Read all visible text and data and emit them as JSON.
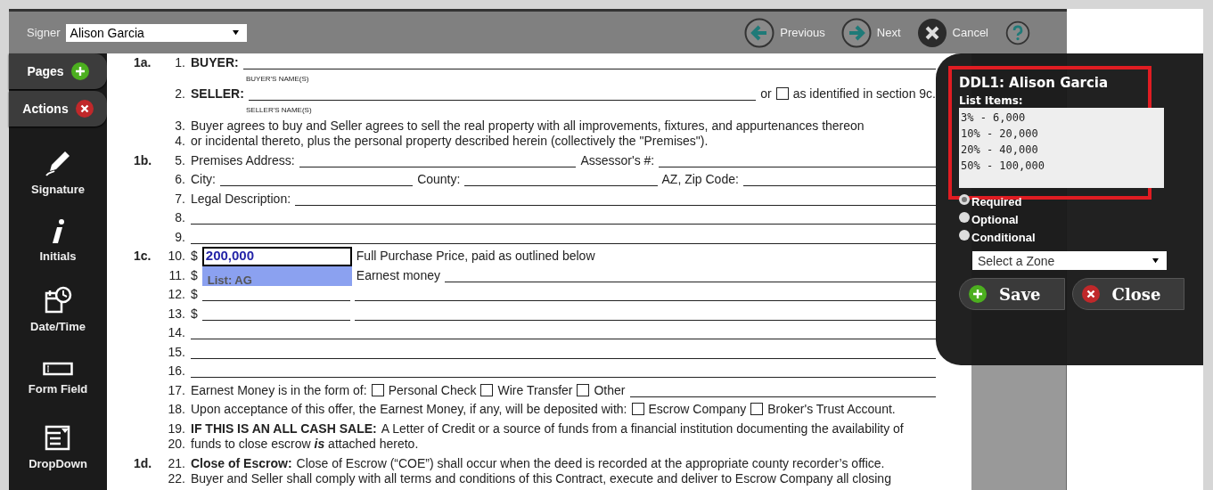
{
  "signer": {
    "label": "Signer",
    "value": "Alison Garcia"
  },
  "nav": [
    {
      "kind": "previous",
      "label": "Previous"
    },
    {
      "kind": "next",
      "label": "Next"
    },
    {
      "kind": "cancel",
      "label": "Cancel"
    },
    {
      "kind": "help"
    }
  ],
  "sidebar": {
    "tabs": [
      {
        "kind": "add",
        "label": "Pages"
      },
      {
        "kind": "remove",
        "label": "Actions"
      }
    ],
    "tools": [
      {
        "kind": "signature",
        "label": "Signature"
      },
      {
        "kind": "initials",
        "label": "Initials"
      },
      {
        "kind": "datetime",
        "label": "Date/Time"
      },
      {
        "kind": "formfield",
        "label": "Form Field"
      },
      {
        "kind": "dropdown",
        "label": "DropDown"
      }
    ]
  },
  "document": {
    "paragraphs": [
      {
        "section": "1a.",
        "lines": [
          {
            "number": "1.",
            "parts": [
              {
                "kind": "bold",
                "text": "BUYER:"
              },
              {
                "kind": "line"
              }
            ],
            "caption": "BUYER'S NAME(S)"
          }
        ]
      },
      {
        "lines": [
          {
            "number": "2.",
            "parts": [
              {
                "kind": "bold",
                "text": "SELLER:"
              },
              {
                "kind": "line"
              },
              {
                "kind": "text",
                "text": "or"
              },
              {
                "kind": "box",
                "checked": false
              },
              {
                "kind": "text",
                "text": "as identified in section 9c."
              }
            ],
            "caption": "SELLER'S NAME(S)"
          }
        ]
      },
      {
        "lines": [
          {
            "number": "3.",
            "parts": [
              {
                "kind": "text",
                "text": "Buyer agrees to buy and Seller agrees to sell the real property with all improvements, fixtures, and appurtenances thereon"
              }
            ]
          },
          {
            "number": "4.",
            "parts": [
              {
                "kind": "text",
                "text": "or incidental thereto, plus the personal property described herein (collectively the \"Premises\")."
              }
            ]
          }
        ]
      },
      {
        "section": "1b.",
        "lines": [
          {
            "number": "5.",
            "parts": [
              {
                "kind": "text",
                "text": "Premises Address:"
              },
              {
                "kind": "line"
              },
              {
                "kind": "text",
                "text": "Assessor's #:"
              },
              {
                "kind": "line"
              }
            ]
          }
        ]
      },
      {
        "lines": [
          {
            "number": "6.",
            "parts": [
              {
                "kind": "text",
                "text": "City:"
              },
              {
                "kind": "line"
              },
              {
                "kind": "text",
                "text": "County:"
              },
              {
                "kind": "line"
              },
              {
                "kind": "text",
                "text": "AZ, Zip Code:"
              },
              {
                "kind": "line"
              }
            ]
          }
        ]
      },
      {
        "lines": [
          {
            "number": "7.",
            "parts": [
              {
                "kind": "text",
                "text": "Legal Description:"
              },
              {
                "kind": "line"
              }
            ]
          }
        ]
      },
      {
        "lines": [
          {
            "number": "8.",
            "parts": [
              {
                "kind": "line"
              }
            ]
          }
        ]
      },
      {
        "lines": [
          {
            "number": "9.",
            "parts": [
              {
                "kind": "line"
              }
            ]
          }
        ]
      },
      {
        "section": "1c.",
        "lines": [
          {
            "number": "10.",
            "parts": [
              {
                "kind": "text",
                "text": "$"
              },
              {
                "kind": "placed_text",
                "value": "200,000"
              },
              {
                "kind": "text",
                "text": "Full Purchase Price, paid as outlined below"
              }
            ]
          }
        ]
      },
      {
        "lines": [
          {
            "number": "11.",
            "parts": [
              {
                "kind": "text",
                "text": "$"
              },
              {
                "kind": "placed_list",
                "label": "List: AG"
              },
              {
                "kind": "text",
                "text": "Earnest money"
              },
              {
                "kind": "line"
              }
            ]
          }
        ]
      },
      {
        "lines": [
          {
            "number": "12.",
            "parts": [
              {
                "kind": "text",
                "text": "$"
              },
              {
                "kind": "short"
              },
              {
                "kind": "line"
              }
            ]
          }
        ]
      },
      {
        "lines": [
          {
            "number": "13.",
            "parts": [
              {
                "kind": "text",
                "text": "$"
              },
              {
                "kind": "short"
              },
              {
                "kind": "line"
              }
            ]
          }
        ]
      },
      {
        "lines": [
          {
            "number": "14.",
            "parts": [
              {
                "kind": "line"
              }
            ]
          }
        ]
      },
      {
        "lines": [
          {
            "number": "15.",
            "parts": [
              {
                "kind": "line"
              }
            ]
          }
        ]
      },
      {
        "lines": [
          {
            "number": "16.",
            "parts": [
              {
                "kind": "line"
              }
            ]
          }
        ]
      },
      {
        "lines": [
          {
            "number": "17.",
            "parts": [
              {
                "kind": "text",
                "text": "Earnest Money is in the form of:"
              },
              {
                "kind": "box",
                "checked": false
              },
              {
                "kind": "text",
                "text": "Personal Check"
              },
              {
                "kind": "box",
                "checked": false
              },
              {
                "kind": "text",
                "text": "Wire Transfer"
              },
              {
                "kind": "box",
                "checked": false
              },
              {
                "kind": "text",
                "text": "Other"
              },
              {
                "kind": "line"
              }
            ]
          }
        ]
      },
      {
        "lines": [
          {
            "number": "18.",
            "parts": [
              {
                "kind": "text",
                "text": "Upon acceptance of this offer, the Earnest Money, if any, will be deposited with:"
              },
              {
                "kind": "box",
                "checked": false
              },
              {
                "kind": "text",
                "text": "Escrow Company"
              },
              {
                "kind": "box",
                "checked": false
              },
              {
                "kind": "text",
                "text": "Broker's Trust Account."
              }
            ]
          }
        ]
      },
      {
        "lines": [
          {
            "number": "19.",
            "parts": [
              {
                "kind": "bold",
                "text": "IF THIS IS AN ALL CASH SALE:"
              },
              {
                "kind": "text",
                "text": "A Letter of Credit or a source of funds from a financial institution documenting the availability of"
              }
            ]
          },
          {
            "number": "20.",
            "parts": [
              {
                "kind": "text",
                "text": "funds to close escrow *is* attached hereto."
              }
            ]
          }
        ]
      },
      {
        "section": "1d.",
        "lines": [
          {
            "number": "21.",
            "parts": [
              {
                "kind": "bold",
                "text": "Close of Escrow:"
              },
              {
                "kind": "text",
                "text": "Close of Escrow (“COE”) shall occur when the deed is recorded at the appropriate county recorder’s office."
              }
            ]
          },
          {
            "number": "22.",
            "parts": [
              {
                "kind": "text",
                "text": "Buyer and Seller shall comply with all terms and conditions of this Contract, execute and deliver to Escrow Company all closing"
              }
            ]
          }
        ]
      }
    ]
  },
  "dialog": {
    "title": "DDL1: Alison Garcia",
    "list_label": "List Items:",
    "list_items": [
      "3% - 6,000",
      "10% - 20,000",
      "20% - 40,000",
      "50% - 100,000"
    ],
    "options": [
      {
        "label": "Required",
        "selected": true
      },
      {
        "label": "Optional",
        "selected": false
      },
      {
        "label": "Conditional",
        "selected": false
      }
    ],
    "zone_select": {
      "placeholder": "Select a Zone"
    },
    "buttons": [
      {
        "kind": "save",
        "label": "Save"
      },
      {
        "kind": "close",
        "label": "Close"
      }
    ]
  }
}
